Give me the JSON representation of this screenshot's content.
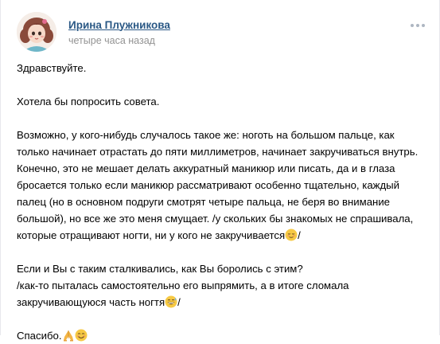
{
  "post": {
    "author_name": "Ирина Плужникова",
    "timestamp": "четыре часа назад",
    "paragraphs": {
      "greeting": "Здравствуйте.",
      "request": "Хотела бы попросить совета.",
      "lines": [
        "Возможно, у кого-нибудь случалось такое же: ноготь на большом пальце, как",
        "только начинает отрастать до пяти миллиметров, начинает закручиваться внутрь.",
        "Конечно, это не мешает делать аккуратный маникюр или писать, да и в глаза",
        "бросается только если маникюр рассматривают особенно тщательно, каждый",
        "палец (но в основном подруги смотрят четыре пальца, не беря во внимание",
        "большой), но все же это меня смущает. /у скольких бы знакомых не спрашивала,",
        "которые отращивают ногти, ни у кого не закручивается",
        "/",
        "Если и Вы с таким сталкивались, как Вы боролись с этим?",
        "/как-то пыталась самостоятельно его выпрямить, а в итоге сломала",
        "закручивающуюся часть ногтя",
        "/",
        "Спасибо."
      ]
    },
    "emoji": {
      "relieved": "relieved-face-emoji",
      "sweat_smile": "grinning-sweat-emoji",
      "pray": "folded-hands-emoji",
      "smile": "smiling-face-emoji"
    },
    "menu_icon": "more-horizontal-icon"
  },
  "colors": {
    "author_link": "#2a5885",
    "timestamp": "#939393",
    "menu_dots": "#aeb7c2"
  }
}
